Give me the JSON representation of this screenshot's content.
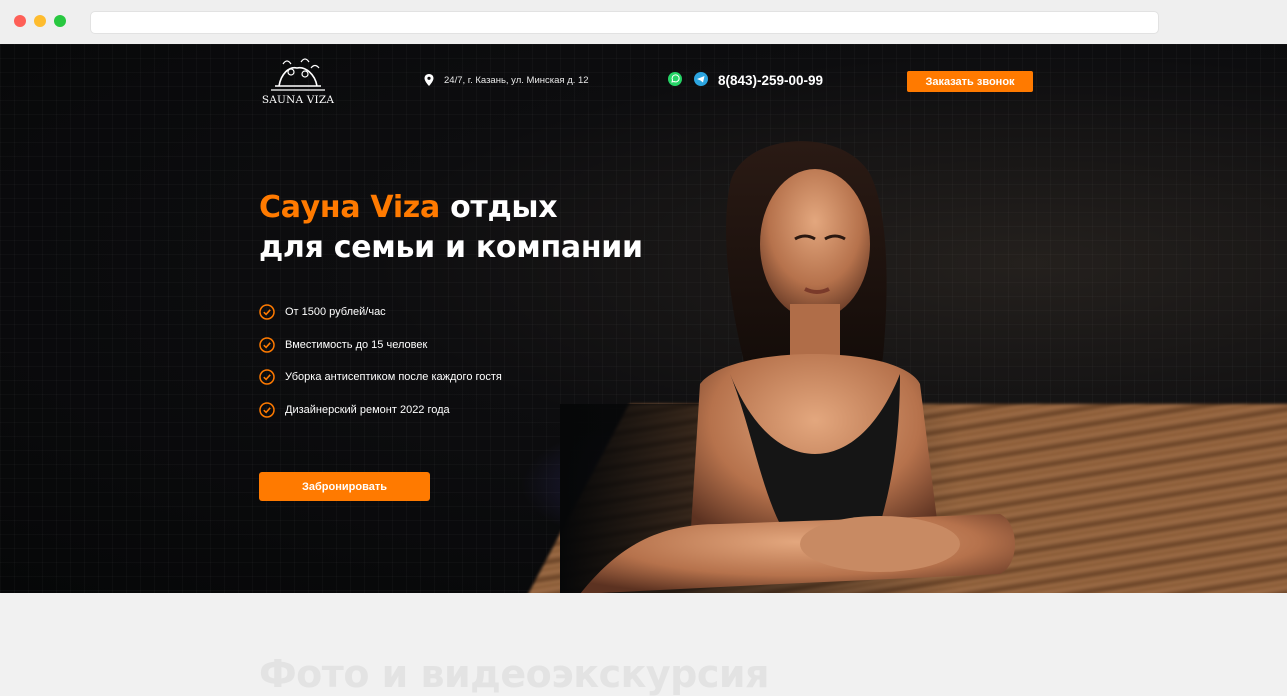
{
  "header": {
    "logo_text": "SAUNA VIZA",
    "address": "24/7, г. Казань, ул. Минская д. 12",
    "phone": "8(843)-259-00-99",
    "callback_label": "Заказать звонок"
  },
  "hero": {
    "title_accent": "Сауна Viza",
    "title_rest": " отдых",
    "title_line2": "для семьи и компании",
    "features": [
      "От 1500 рублей/час",
      "Вместимость до 15 человек",
      "Уборка антисептиком после каждого гостя",
      "Дизайнерский ремонт 2022 года"
    ],
    "book_label": "Забронировать"
  },
  "next_section": {
    "title": "Фото и видеоэкскурсия"
  },
  "colors": {
    "accent": "#ff7a00",
    "hero_bg": "#0b0b0d",
    "page_bg": "#f1f1f1"
  },
  "icons": [
    "location-pin-icon",
    "whatsapp-icon",
    "telegram-icon",
    "check-circle-icon"
  ]
}
